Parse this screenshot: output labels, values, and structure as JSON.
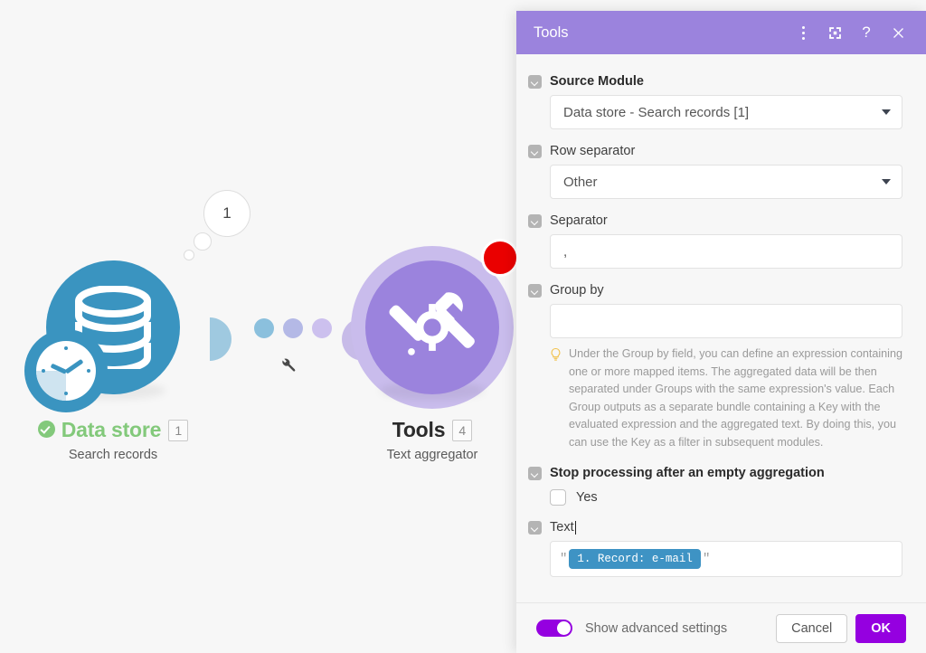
{
  "canvas": {
    "bubble_counter": "1",
    "modules": [
      {
        "name": "Data store",
        "badge": "1",
        "subtitle": "Search records",
        "icon": "database-icon",
        "accent": "#3a94c0",
        "status": "ok"
      },
      {
        "name": "Tools",
        "badge": "4",
        "subtitle": "Text aggregator",
        "icon": "tools-icon",
        "accent": "#9b83dd",
        "status": "error"
      }
    ],
    "connector_icon": "wrench-icon"
  },
  "panel": {
    "title": "Tools",
    "header_icons": [
      "kebab-menu-icon",
      "expand-icon",
      "help-icon",
      "close-icon"
    ],
    "fields": {
      "source_module": {
        "label": "Source Module",
        "value": "Data store - Search records [1]",
        "control": "select"
      },
      "row_separator": {
        "label": "Row separator",
        "value": "Other",
        "control": "select"
      },
      "separator": {
        "label": "Separator",
        "value": ",",
        "control": "text"
      },
      "group_by": {
        "label": "Group by",
        "value": "",
        "control": "text"
      },
      "hint": {
        "icon": "lightbulb-icon",
        "text": "Under the Group by field, you can define an expression containing one or more mapped items. The aggregated data will be then separated under Groups with the same expression's value. Each Group outputs as a separate bundle containing a Key with the evaluated expression and the aggregated text. By doing this, you can use the Key as a filter in subsequent modules."
      },
      "stop_processing": {
        "label": "Stop processing after an empty aggregation",
        "checkbox_label": "Yes",
        "checked": false
      },
      "text": {
        "label": "Text",
        "open_quote": "\"",
        "close_quote": "\"",
        "token": "1. Record: e-mail"
      }
    },
    "footer": {
      "advanced_label": "Show advanced settings",
      "advanced_on": true,
      "cancel_label": "Cancel",
      "ok_label": "OK"
    }
  },
  "colors": {
    "panel_header": "#9b83dd",
    "primary_button": "#9500e0",
    "module_blue": "#3a94c0",
    "module_purple": "#9b83dd",
    "token_blue": "#3e93c4",
    "status_green": "#83c97b",
    "status_red": "#ea0000"
  }
}
